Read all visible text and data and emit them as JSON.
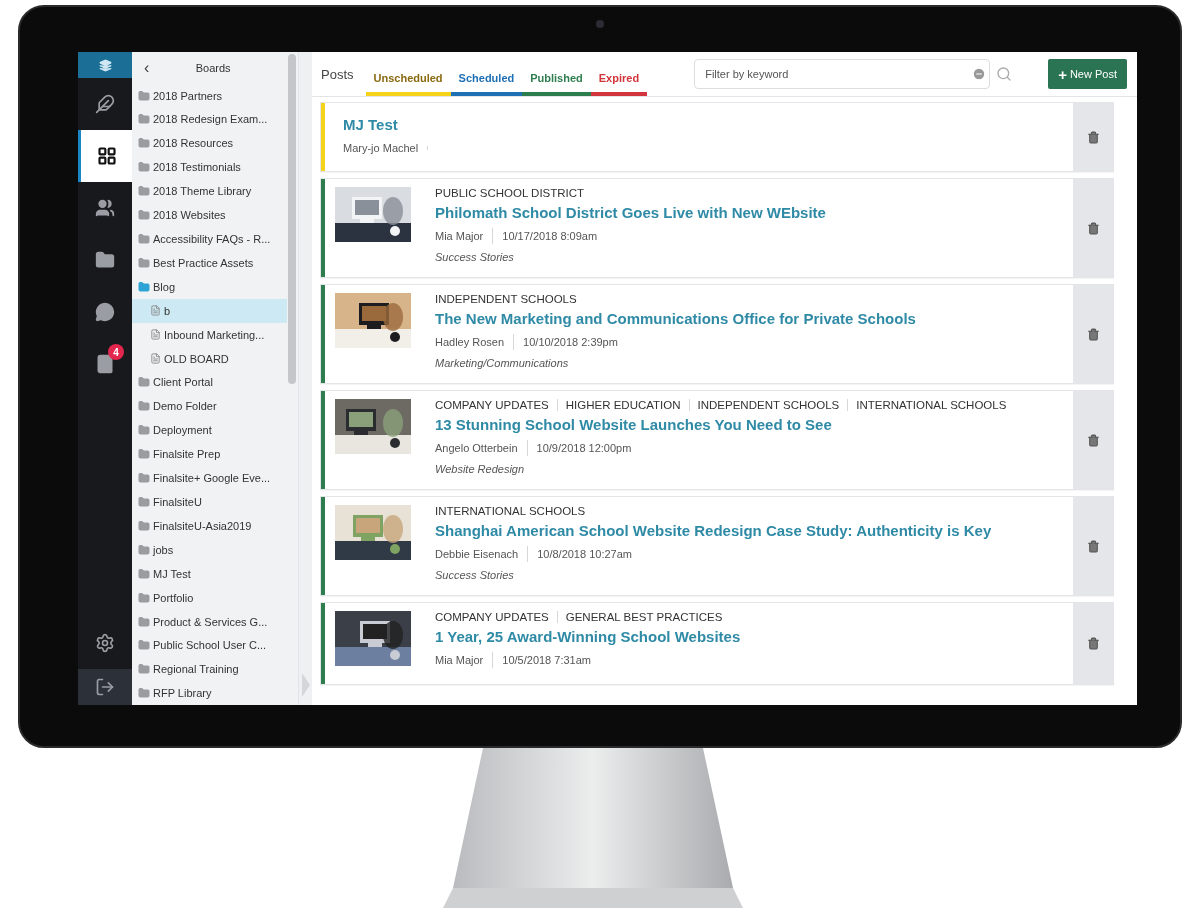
{
  "rail": {
    "items": [
      {
        "kind": "logo",
        "selected": false
      },
      {
        "kind": "feather",
        "selected": false
      },
      {
        "kind": "boards",
        "selected": true
      },
      {
        "kind": "users",
        "selected": false
      },
      {
        "kind": "folder",
        "selected": false
      },
      {
        "kind": "chat",
        "selected": false
      },
      {
        "kind": "book",
        "selected": false,
        "badge": "4"
      },
      {
        "kind": "settings",
        "selected": false
      },
      {
        "kind": "logout",
        "selected": false
      }
    ]
  },
  "boards": {
    "title": "Boards",
    "back": "‹",
    "items": [
      {
        "label": "2018 Partners",
        "selected": false,
        "expanded": false
      },
      {
        "label": "2018 Redesign Exam...",
        "selected": false,
        "expanded": false
      },
      {
        "label": "2018 Resources",
        "selected": false,
        "expanded": false
      },
      {
        "label": "2018 Testimonials",
        "selected": false,
        "expanded": false
      },
      {
        "label": "2018 Theme Library",
        "selected": false,
        "expanded": false
      },
      {
        "label": "2018 Websites",
        "selected": false,
        "expanded": false
      },
      {
        "label": "Accessibility FAQs - R...",
        "selected": false,
        "expanded": false
      },
      {
        "label": "Best Practice Assets",
        "selected": false,
        "expanded": false
      },
      {
        "label": "Blog",
        "selected": false,
        "expanded": true,
        "children": [
          {
            "label": "b",
            "selected": true
          },
          {
            "label": "Inbound Marketing...",
            "selected": false
          },
          {
            "label": "OLD BOARD",
            "selected": false
          }
        ]
      },
      {
        "label": "Client Portal",
        "selected": false,
        "expanded": false
      },
      {
        "label": "Demo Folder",
        "selected": false,
        "expanded": false
      },
      {
        "label": "Deployment",
        "selected": false,
        "expanded": false
      },
      {
        "label": "Finalsite Prep",
        "selected": false,
        "expanded": false
      },
      {
        "label": "Finalsite+ Google Eve...",
        "selected": false,
        "expanded": false
      },
      {
        "label": "FinalsiteU",
        "selected": false,
        "expanded": false
      },
      {
        "label": "FinalsiteU-Asia2019",
        "selected": false,
        "expanded": false
      },
      {
        "label": "jobs",
        "selected": false,
        "expanded": false
      },
      {
        "label": "MJ Test",
        "selected": false,
        "expanded": false
      },
      {
        "label": "Portfolio",
        "selected": false,
        "expanded": false
      },
      {
        "label": "Product & Services G...",
        "selected": false,
        "expanded": false
      },
      {
        "label": "Public School User C...",
        "selected": false,
        "expanded": false
      },
      {
        "label": "Regional Training",
        "selected": false,
        "expanded": false
      },
      {
        "label": "RFP Library",
        "selected": false,
        "expanded": false
      }
    ]
  },
  "header": {
    "title": "Posts",
    "tabs": [
      {
        "label": "Unscheduled",
        "color": "#f5d31b"
      },
      {
        "label": "Scheduled",
        "color": "#1f6fb5"
      },
      {
        "label": "Published",
        "color": "#2e7d4f"
      },
      {
        "label": "Expired",
        "color": "#d2353b"
      }
    ],
    "filter": {
      "placeholder": "Filter by keyword"
    },
    "new_post": {
      "icon": "+",
      "label": "New Post"
    }
  },
  "posts": [
    {
      "color": "#f5d31b",
      "title": "MJ Test",
      "author": "Mary-jo Machel"
    },
    {
      "color": "#2e7d4f",
      "thumbnail": {
        "kind": "picture"
      },
      "categories": [
        "PUBLIC SCHOOL DISTRICT"
      ],
      "title": "Philomath School District Goes Live with New WEbsite",
      "author": "Mia Major",
      "date": "10/17/2018 8:09am",
      "topic": "Success Stories"
    },
    {
      "color": "#2e7d4f",
      "thumbnail": {
        "kind": "picture"
      },
      "categories": [
        "INDEPENDENT SCHOOLS"
      ],
      "title": "The New Marketing and Communications Office for Private Schools",
      "author": "Hadley Rosen",
      "date": "10/10/2018 2:39pm",
      "topic": "Marketing/Communications"
    },
    {
      "color": "#2e7d4f",
      "thumbnail": {
        "kind": "picture"
      },
      "categories": [
        "COMPANY UPDATES",
        "HIGHER EDUCATION",
        "INDEPENDENT SCHOOLS",
        "INTERNATIONAL SCHOOLS"
      ],
      "title": "13 Stunning School Website Launches You Need to See",
      "author": "Angelo Otterbein",
      "date": "10/9/2018 12:00pm",
      "topic": "Website Redesign"
    },
    {
      "color": "#2e7d4f",
      "thumbnail": {
        "kind": "picture"
      },
      "categories": [
        "INTERNATIONAL SCHOOLS"
      ],
      "title": "Shanghai American School Website Redesign Case Study: Authenticity is Key",
      "author": "Debbie Eisenach",
      "date": "10/8/2018 10:27am",
      "topic": "Success Stories"
    },
    {
      "color": "#2e7d4f",
      "thumbnail": {
        "kind": "picture"
      },
      "categories": [
        "COMPANY UPDATES",
        "GENERAL BEST PRACTICES"
      ],
      "title": "1 Year, 25 Award-Winning School Websites",
      "author": "Mia Major",
      "date": "10/5/2018 7:31am"
    }
  ]
}
